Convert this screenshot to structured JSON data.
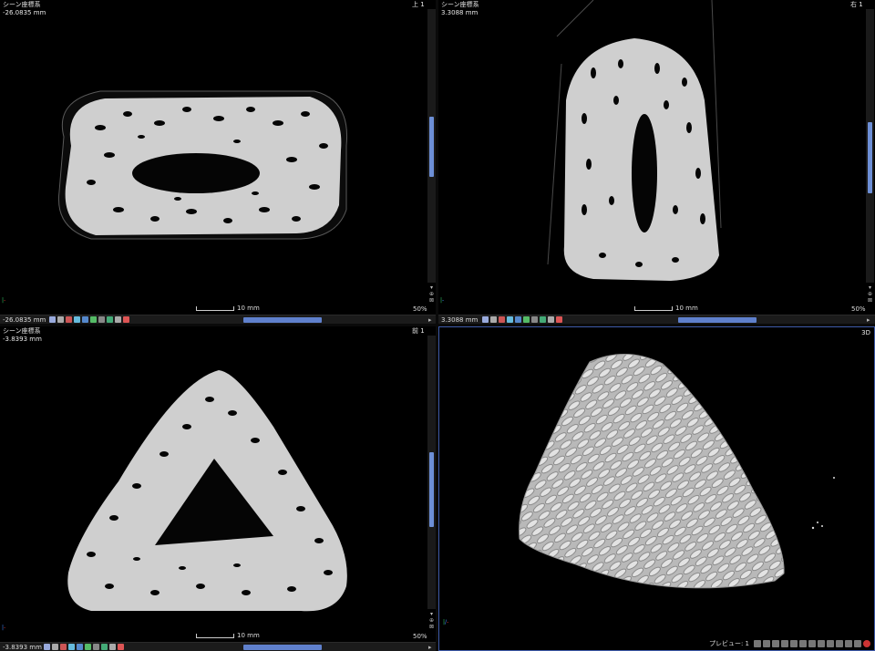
{
  "top_view": {
    "coord_title": "シーン座標系",
    "coord_value": "-26.0835 mm",
    "view_name": "上 1",
    "zoom": "50%",
    "scale_label": "10 mm",
    "status_value": "-26.0835 mm"
  },
  "right_view": {
    "coord_title": "シーン座標系",
    "coord_value": "3.3088 mm",
    "view_name": "右 1",
    "zoom": "50%",
    "scale_label": "10 mm",
    "status_value": "3.3088 mm"
  },
  "front_view": {
    "coord_title": "シーン座標系",
    "coord_value": "-3.8393 mm",
    "view_name": "前 1",
    "zoom": "50%",
    "scale_label": "10 mm",
    "status_value": "-3.8393 mm"
  },
  "view_3d": {
    "label": "3D",
    "preview_label": "プレビュー: 1"
  },
  "colors": {
    "accent": "#6d8fd6",
    "grain": "#e4e4e4",
    "background": "#000000"
  }
}
